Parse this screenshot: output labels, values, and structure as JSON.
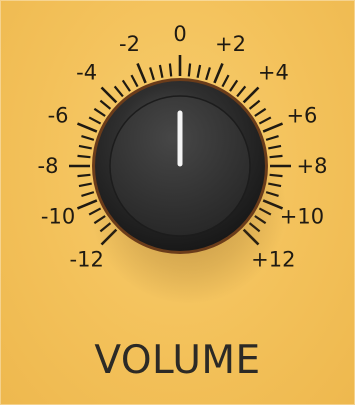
{
  "control": {
    "label": "VOLUME",
    "value": 0,
    "min": -12,
    "max": 12
  },
  "scale": {
    "labels": [
      "-12",
      "-10",
      "-8",
      "-6",
      "-4",
      "-2",
      "0",
      "+2",
      "+4",
      "+6",
      "+8",
      "+10",
      "+12"
    ]
  },
  "colors": {
    "panel": "#f3c15a",
    "ink": "#1f1a12",
    "knob": "#2e2e2e",
    "pointer": "#ffffff"
  }
}
